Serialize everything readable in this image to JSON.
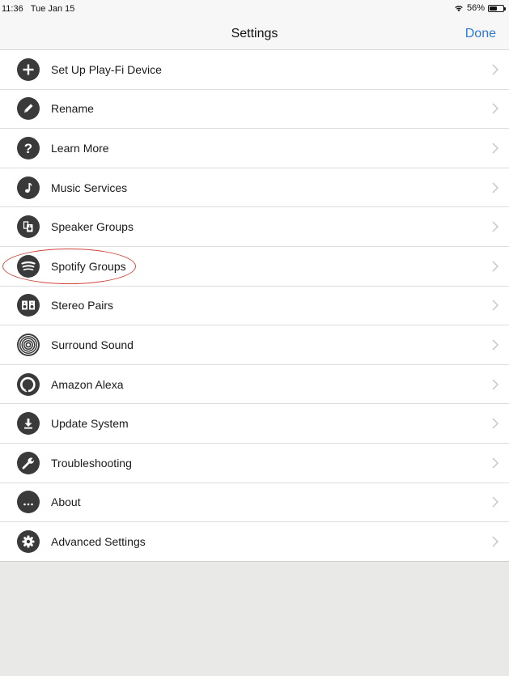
{
  "status_bar": {
    "time": "11:36",
    "date": "Tue Jan 15",
    "battery_percent": "56%",
    "battery_level": 0.56
  },
  "nav": {
    "title": "Settings",
    "done_label": "Done"
  },
  "colors": {
    "accent": "#2f7ad1",
    "icon_bg": "#3a3a3a",
    "highlight": "#d0453b",
    "background": "#e9e9e7"
  },
  "settings_items": [
    {
      "label": "Set Up Play-Fi Device",
      "icon": "plus-icon"
    },
    {
      "label": "Rename",
      "icon": "pencil-icon"
    },
    {
      "label": "Learn More",
      "icon": "question-icon"
    },
    {
      "label": "Music Services",
      "icon": "music-note-icon"
    },
    {
      "label": "Speaker Groups",
      "icon": "speaker-groups-icon"
    },
    {
      "label": "Spotify Groups",
      "icon": "spotify-icon",
      "highlighted": true
    },
    {
      "label": "Stereo Pairs",
      "icon": "stereo-pair-icon"
    },
    {
      "label": "Surround Sound",
      "icon": "surround-sound-icon"
    },
    {
      "label": "Amazon Alexa",
      "icon": "alexa-icon"
    },
    {
      "label": "Update System",
      "icon": "download-icon"
    },
    {
      "label": "Troubleshooting",
      "icon": "wrench-icon"
    },
    {
      "label": "About",
      "icon": "ellipsis-icon"
    },
    {
      "label": "Advanced Settings",
      "icon": "gear-icon"
    }
  ]
}
